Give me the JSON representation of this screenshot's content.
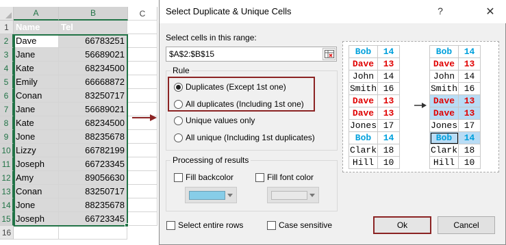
{
  "sheet": {
    "columns": [
      "A",
      "B",
      "C"
    ],
    "rows": [
      "1",
      "2",
      "3",
      "4",
      "5",
      "6",
      "7",
      "8",
      "9",
      "10",
      "11",
      "12",
      "13",
      "14",
      "15",
      "16"
    ],
    "header": {
      "name": "Name",
      "tel": "Tel"
    },
    "data": [
      {
        "name": "Dave",
        "tel": "66783251"
      },
      {
        "name": "Jane",
        "tel": "56689021"
      },
      {
        "name": "Kate",
        "tel": "68234500"
      },
      {
        "name": "Emily",
        "tel": "66668872"
      },
      {
        "name": "Conan",
        "tel": "83250717"
      },
      {
        "name": "Jane",
        "tel": "56689021"
      },
      {
        "name": "Kate",
        "tel": "68234500"
      },
      {
        "name": "Jone",
        "tel": "88235678"
      },
      {
        "name": "Lizzy",
        "tel": "66782199"
      },
      {
        "name": "Joseph",
        "tel": "66723345"
      },
      {
        "name": "Amy",
        "tel": "89056630"
      },
      {
        "name": "Conan",
        "tel": "83250717"
      },
      {
        "name": "Jone",
        "tel": "88235678"
      },
      {
        "name": "Joseph",
        "tel": "66723345"
      }
    ]
  },
  "dialog": {
    "title": "Select Duplicate & Unique Cells",
    "help_label": "?",
    "close_label": "✕",
    "range_label": "Select cells in this range:",
    "range_value": "$A$2:$B$15",
    "rule": {
      "title": "Rule",
      "options": [
        {
          "label": "Duplicates (Except 1st one)",
          "selected": true
        },
        {
          "label": "All duplicates (Including 1st one)",
          "selected": false
        },
        {
          "label": "Unique values only",
          "selected": false
        },
        {
          "label": "All unique (Including 1st duplicates)",
          "selected": false
        }
      ]
    },
    "processing": {
      "title": "Processing of results",
      "fill_backcolor_label": "Fill backcolor",
      "fill_fontcolor_label": "Fill font color",
      "backcolor": "#87cde8",
      "fontcolor": "#e8e8e8"
    },
    "select_entire_rows_label": "Select entire rows",
    "case_sensitive_label": "Case sensitive",
    "ok_label": "Ok",
    "cancel_label": "Cancel"
  },
  "preview": {
    "left": [
      {
        "name": "Bob",
        "val": "14",
        "style": "blue"
      },
      {
        "name": "Dave",
        "val": "13",
        "style": "red"
      },
      {
        "name": "John",
        "val": "14",
        "style": ""
      },
      {
        "name": "Smith",
        "val": "16",
        "style": ""
      },
      {
        "name": "Dave",
        "val": "13",
        "style": "red"
      },
      {
        "name": "Dave",
        "val": "13",
        "style": "red"
      },
      {
        "name": "Jones",
        "val": "17",
        "style": ""
      },
      {
        "name": "Bob",
        "val": "14",
        "style": "blue"
      },
      {
        "name": "Clark",
        "val": "18",
        "style": ""
      },
      {
        "name": "Hill",
        "val": "10",
        "style": ""
      }
    ],
    "right": [
      {
        "name": "Bob",
        "val": "14",
        "style": "blue"
      },
      {
        "name": "Dave",
        "val": "13",
        "style": "red"
      },
      {
        "name": "John",
        "val": "14",
        "style": ""
      },
      {
        "name": "Smith",
        "val": "16",
        "style": ""
      },
      {
        "name": "Dave",
        "val": "13",
        "style": "red hl"
      },
      {
        "name": "Dave",
        "val": "13",
        "style": "red hl"
      },
      {
        "name": "Jones",
        "val": "17",
        "style": ""
      },
      {
        "name": "Bob",
        "val": "14",
        "style": "blue hl"
      },
      {
        "name": "Clark",
        "val": "18",
        "style": ""
      },
      {
        "name": "Hill",
        "val": "10",
        "style": ""
      }
    ]
  }
}
